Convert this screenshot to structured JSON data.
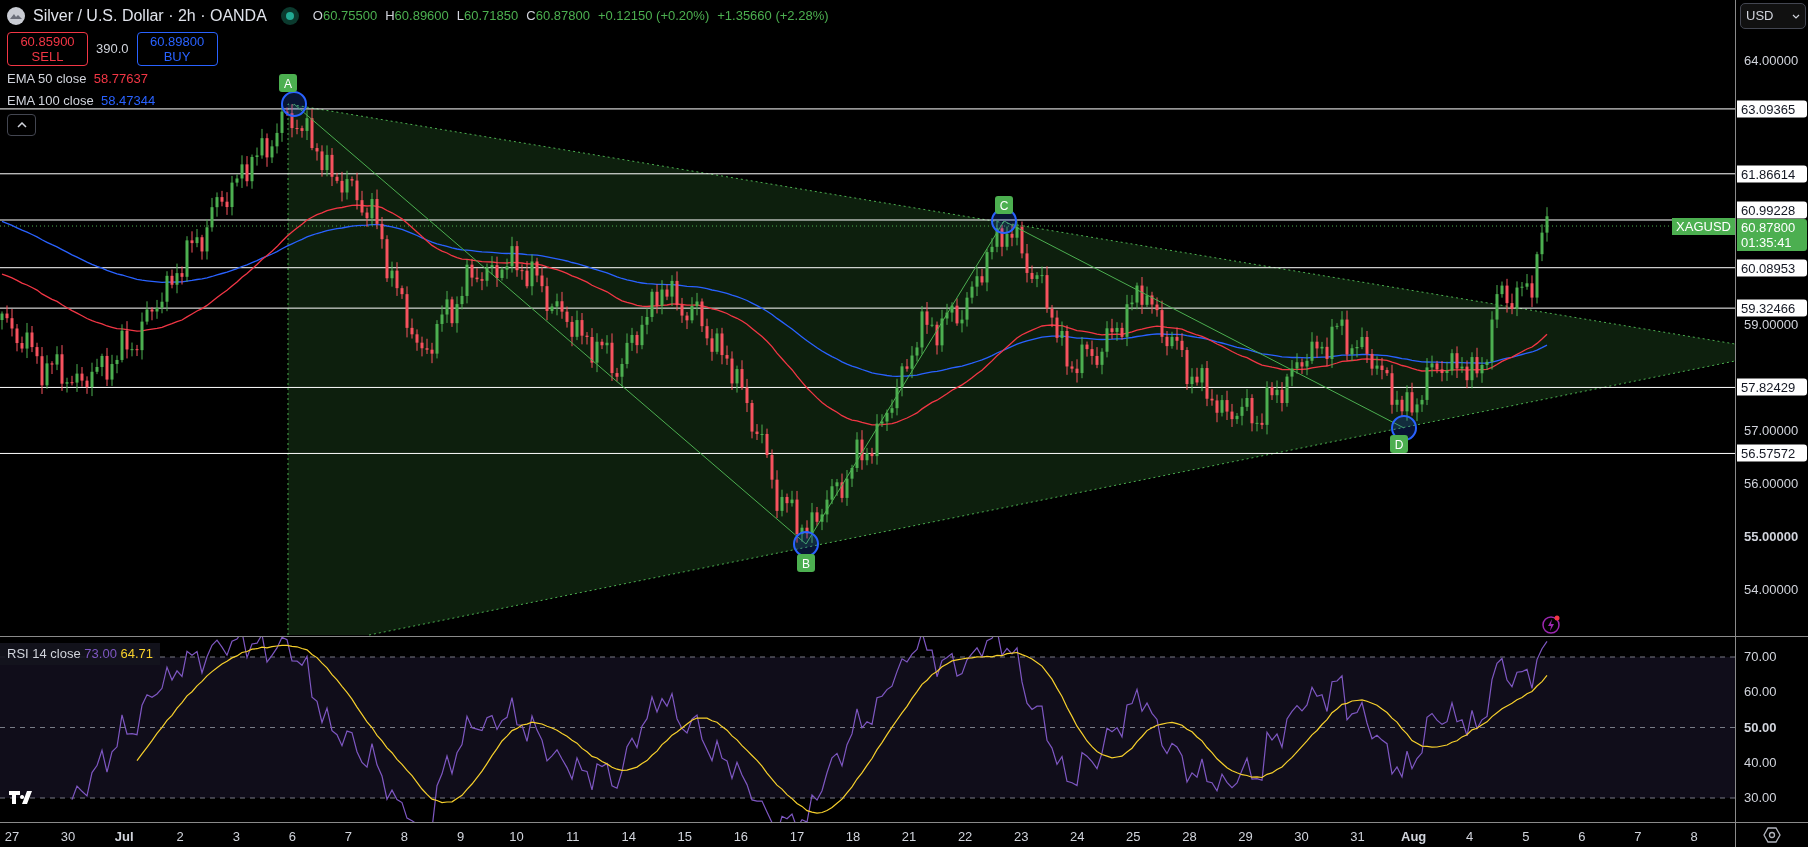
{
  "header": {
    "title": "Silver / U.S. Dollar · 2h · OANDA",
    "ohlc": [
      {
        "label": "O",
        "value": "60.75500"
      },
      {
        "label": "H",
        "value": "60.89600"
      },
      {
        "label": "L",
        "value": "60.71850"
      },
      {
        "label": "C",
        "value": "60.87800"
      }
    ],
    "change": "+0.12150 (+0.20%)",
    "change_total": "+1.35660 (+2.28%)"
  },
  "trade": {
    "sell": {
      "price": "60.85900",
      "label": "SELL"
    },
    "spread": "390.0",
    "buy": {
      "price": "60.89800",
      "label": "BUY"
    }
  },
  "indicators": [
    {
      "name": "EMA 50 close",
      "value": "58.77637",
      "color": "#f23645"
    },
    {
      "name": "EMA 100 close",
      "value": "58.47344",
      "color": "#2962ff"
    }
  ],
  "currency": "USD",
  "price_axis": [
    {
      "label": "64.00000",
      "bold": false
    },
    {
      "label": "59.00000",
      "bold": false
    },
    {
      "label": "57.00000",
      "bold": false
    },
    {
      "label": "56.00000",
      "bold": false
    },
    {
      "label": "55.00000",
      "bold": true
    },
    {
      "label": "54.00000",
      "bold": false
    }
  ],
  "levels": [
    {
      "label": "63.09365"
    },
    {
      "label": "61.86614"
    },
    {
      "label": "60.99228"
    },
    {
      "label": "60.08953"
    },
    {
      "label": "59.32466"
    },
    {
      "label": "57.82429"
    },
    {
      "label": "56.57572"
    }
  ],
  "last_price": {
    "symbol": "XAGUSD",
    "price": "60.87800",
    "countdown": "01:35:41"
  },
  "patterns": [
    {
      "label": "A"
    },
    {
      "label": "B"
    },
    {
      "label": "C"
    },
    {
      "label": "D"
    }
  ],
  "rsi": {
    "name": "RSI 14 close",
    "value": "73.00",
    "ma_value": "64.71",
    "ticks": [
      {
        "label": "70.00",
        "bold": false
      },
      {
        "label": "60.00",
        "bold": false
      },
      {
        "label": "50.00",
        "bold": true
      },
      {
        "label": "40.00",
        "bold": false
      },
      {
        "label": "30.00",
        "bold": false
      }
    ]
  },
  "time_axis": [
    {
      "label": "27",
      "bold": false
    },
    {
      "label": "30",
      "bold": false
    },
    {
      "label": "Jul",
      "bold": true
    },
    {
      "label": "2",
      "bold": false
    },
    {
      "label": "3",
      "bold": false
    },
    {
      "label": "6",
      "bold": false
    },
    {
      "label": "7",
      "bold": false
    },
    {
      "label": "8",
      "bold": false
    },
    {
      "label": "9",
      "bold": false
    },
    {
      "label": "10",
      "bold": false
    },
    {
      "label": "11",
      "bold": false
    },
    {
      "label": "14",
      "bold": false
    },
    {
      "label": "15",
      "bold": false
    },
    {
      "label": "16",
      "bold": false
    },
    {
      "label": "17",
      "bold": false
    },
    {
      "label": "18",
      "bold": false
    },
    {
      "label": "21",
      "bold": false
    },
    {
      "label": "22",
      "bold": false
    },
    {
      "label": "23",
      "bold": false
    },
    {
      "label": "24",
      "bold": false
    },
    {
      "label": "25",
      "bold": false
    },
    {
      "label": "28",
      "bold": false
    },
    {
      "label": "29",
      "bold": false
    },
    {
      "label": "30",
      "bold": false
    },
    {
      "label": "31",
      "bold": false
    },
    {
      "label": "Aug",
      "bold": true
    },
    {
      "label": "4",
      "bold": false
    },
    {
      "label": "5",
      "bold": false
    },
    {
      "label": "6",
      "bold": false
    },
    {
      "label": "7",
      "bold": false
    },
    {
      "label": "8",
      "bold": false
    }
  ]
}
